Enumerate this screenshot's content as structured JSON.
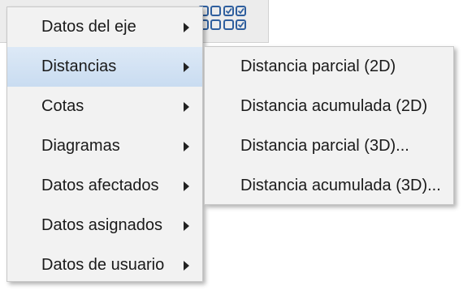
{
  "context_menu": {
    "items": [
      {
        "label": "Datos del eje",
        "highlighted": false
      },
      {
        "label": "Distancias",
        "highlighted": true
      },
      {
        "label": "Cotas",
        "highlighted": false
      },
      {
        "label": "Diagramas",
        "highlighted": false
      },
      {
        "label": "Datos afectados",
        "highlighted": false
      },
      {
        "label": "Datos asignados",
        "highlighted": false
      },
      {
        "label": "Datos de usuario",
        "highlighted": false
      }
    ]
  },
  "submenu": {
    "items": [
      {
        "label": "Distancia parcial (2D)"
      },
      {
        "label": "Distancia acumulada (2D)"
      },
      {
        "label": "Distancia parcial (3D)..."
      },
      {
        "label": "Distancia acumulada (3D)..."
      }
    ]
  },
  "toolbar": {
    "icons": [
      "grid-icon",
      "checkbox-grid-icon"
    ]
  },
  "colors": {
    "menu_background": "#f2f2f2",
    "highlight": "#c9dcf1",
    "border": "#c8c8c8",
    "icon_blue": "#2f5f9e"
  }
}
